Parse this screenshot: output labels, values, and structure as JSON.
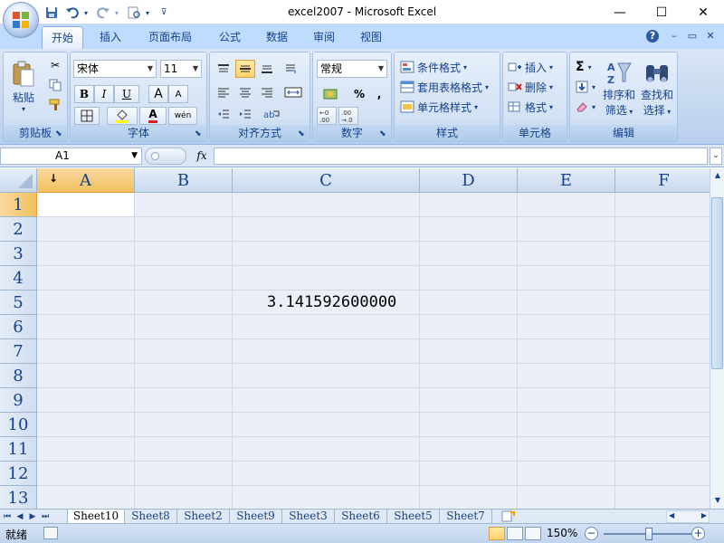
{
  "window": {
    "title": "excel2007 - Microsoft Excel",
    "minimize_glyph": "—",
    "maximize_glyph": "☐",
    "close_glyph": "✕"
  },
  "quick_access": {
    "icons": [
      "save-icon",
      "undo-icon",
      "redo-icon",
      "print-preview-icon",
      "customize-qat-icon"
    ]
  },
  "tabs": [
    {
      "label": "开始",
      "active": true
    },
    {
      "label": "插入",
      "active": false
    },
    {
      "label": "页面布局",
      "active": false
    },
    {
      "label": "公式",
      "active": false
    },
    {
      "label": "数据",
      "active": false
    },
    {
      "label": "审阅",
      "active": false
    },
    {
      "label": "视图",
      "active": false
    }
  ],
  "ribbon": {
    "clipboard": {
      "label": "剪贴板",
      "paste": "粘贴"
    },
    "font": {
      "label": "字体",
      "font_name": "宋体",
      "font_size": "11",
      "bold": "B",
      "italic": "I",
      "underline": "U",
      "grow": "A",
      "shrink": "A",
      "font_color_glyph": "A",
      "phonetic_glyph": "wén"
    },
    "alignment": {
      "label": "对齐方式"
    },
    "number": {
      "label": "数字",
      "format": "常规",
      "percent": "%",
      "comma": ",",
      "inc_decimal": ".0→.00",
      "dec_decimal": ".00→.0"
    },
    "styles": {
      "label": "样式",
      "conditional": "条件格式",
      "table": "套用表格格式",
      "cell_styles": "单元格样式"
    },
    "cells": {
      "label": "单元格",
      "insert": "插入",
      "delete": "删除",
      "format": "格式"
    },
    "editing": {
      "label": "编辑",
      "sum_glyph": "Σ",
      "sort_line1": "排序和",
      "sort_line2": "筛选",
      "find_line1": "查找和",
      "find_line2": "选择"
    }
  },
  "formula_bar": {
    "name_box": "A1",
    "fx": "fx",
    "formula": ""
  },
  "grid": {
    "columns": [
      "A",
      "B",
      "C",
      "D",
      "E",
      "F"
    ],
    "rows": [
      "1",
      "2",
      "3",
      "4",
      "5",
      "6",
      "7",
      "8",
      "9",
      "10",
      "11",
      "12",
      "13"
    ],
    "active_cell": "A1",
    "cells": {
      "C5": "3.141592600000"
    }
  },
  "sheets": [
    {
      "name": "Sheet10",
      "active": true
    },
    {
      "name": "Sheet8",
      "active": false
    },
    {
      "name": "Sheet2",
      "active": false
    },
    {
      "name": "Sheet9",
      "active": false
    },
    {
      "name": "Sheet3",
      "active": false
    },
    {
      "name": "Sheet6",
      "active": false
    },
    {
      "name": "Sheet5",
      "active": false
    },
    {
      "name": "Sheet7",
      "active": false
    }
  ],
  "status": {
    "ready": "就绪",
    "zoom": "150%",
    "zoom_percent": 150
  },
  "colors": {
    "ribbon_text": "#15428b",
    "header_active": "#f1c15f",
    "grid_bg": "#eaeff8"
  }
}
